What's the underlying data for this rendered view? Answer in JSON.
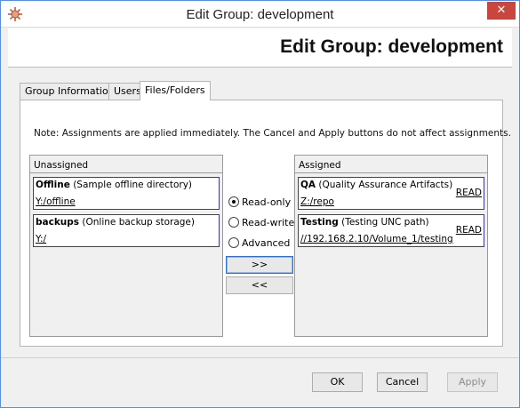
{
  "window": {
    "title": "Edit Group: development",
    "close_glyph": "✕",
    "icon": "app-icon"
  },
  "header": {
    "title": "Edit Group: development"
  },
  "tabs": [
    {
      "label": "Group Information",
      "active": false
    },
    {
      "label": "Users",
      "active": false
    },
    {
      "label": "Files/Folders",
      "active": true
    }
  ],
  "note": "Note: Assignments are applied immediately. The Cancel and Apply buttons do not affect assignments.",
  "unassigned": {
    "header": "Unassigned",
    "items": [
      {
        "name": "Offline",
        "description": "(Sample offline directory)",
        "path": "Y:/offline"
      },
      {
        "name": "backups",
        "description": "(Online backup storage)",
        "path": "Y:/"
      }
    ]
  },
  "access_options": [
    {
      "label": "Read-only",
      "checked": true
    },
    {
      "label": "Read-write",
      "checked": false
    },
    {
      "label": "Advanced",
      "checked": false
    }
  ],
  "move_buttons": {
    "assign": ">>",
    "unassign": "<<"
  },
  "assigned": {
    "header": "Assigned",
    "items": [
      {
        "name": "QA",
        "description": "(Quality Assurance Artifacts)",
        "path": "Z:/repo",
        "permission": "READ"
      },
      {
        "name": "Testing",
        "description": "(Testing UNC path)",
        "path": "//192.168.2.10/Volume_1/testing",
        "permission": "READ"
      }
    ]
  },
  "footer": {
    "ok": "OK",
    "cancel": "Cancel",
    "apply": "Apply"
  },
  "colors": {
    "accent": "#5a8ed8",
    "close": "#c9463d",
    "item_border": "#3a3a9a"
  }
}
